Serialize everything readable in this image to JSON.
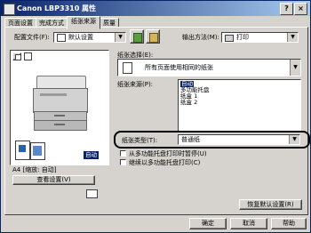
{
  "window": {
    "title": "Canon LBP3310 属性",
    "close_glyph": "×"
  },
  "tabs": [
    "页面设置",
    "完成方式",
    "纸张来源",
    "质量"
  ],
  "profile": {
    "label": "配置文件(F):",
    "value": "默认设置"
  },
  "output": {
    "label": "输出方法(M):",
    "value": "打印"
  },
  "paper_selection": {
    "label": "纸张选择(E):",
    "value": "所有页面使用相同的纸张"
  },
  "paper_source": {
    "label": "纸张来源(P):",
    "options": [
      "自动",
      "多功能托盘",
      "纸盒 1",
      "纸盒 2"
    ],
    "selected": "自动"
  },
  "paper_type": {
    "label": "纸张类型(T):",
    "value": "普通纸"
  },
  "checkboxes": [
    "从多功能托盘打印时暂停(U)",
    "继续以多功能托盘打印(C)"
  ],
  "preview": {
    "status_text": "A4 [缩放: 自动]",
    "badge": "自动",
    "view_settings": "查看设置(V)"
  },
  "restore_defaults": "恢复默认设置(R)",
  "footer": {
    "ok": "确定",
    "cancel": "取消",
    "help": "帮助"
  }
}
